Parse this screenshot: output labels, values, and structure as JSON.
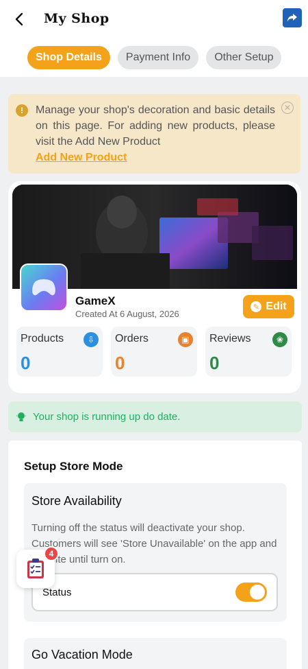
{
  "header": {
    "title": "My Shop"
  },
  "tabs": [
    {
      "label": "Shop Details"
    },
    {
      "label": "Payment Info"
    },
    {
      "label": "Other Setup"
    }
  ],
  "notice": {
    "text": "Manage your shop's decoration and basic details on this page. For adding new products, please visit the Add New Product",
    "link": "Add New Product"
  },
  "shop": {
    "name": "GameX",
    "created": "Created At 6 August, 2026",
    "edit_label": "Edit",
    "stats": [
      {
        "label": "Products",
        "value": "0",
        "color": "#2d8fe0"
      },
      {
        "label": "Orders",
        "value": "0",
        "color": "#e9822f"
      },
      {
        "label": "Reviews",
        "value": "0",
        "color": "#2f8a47"
      }
    ]
  },
  "status_message": "Your shop is running up do date.",
  "setup": {
    "title": "Setup Store Mode",
    "availability": {
      "title": "Store Availability",
      "desc": "Turning off the status will deactivate your shop. Customers will see 'Store Unavailable' on the app and website until turn on.",
      "status_label": "Status",
      "status_on": true
    },
    "vacation": {
      "title": "Go Vacation Mode"
    }
  },
  "fab": {
    "badge": "4"
  },
  "colors": {
    "accent": "#f3a21a",
    "success": "#1eb05e"
  }
}
